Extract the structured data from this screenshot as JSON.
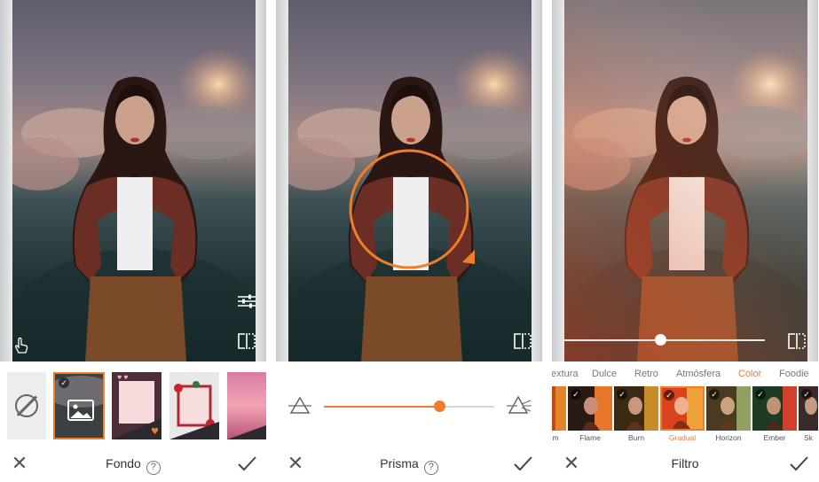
{
  "panels": [
    {
      "id": "fondo",
      "title": "Fondo",
      "has_help": true,
      "tray": {
        "type": "background-picker",
        "selected_index": 1,
        "tiles": [
          "none-icon",
          "image-icon",
          "pink-frame-hearts",
          "rose-frame",
          "pink-sunset"
        ]
      }
    },
    {
      "id": "prisma",
      "title": "Prisma",
      "has_help": true,
      "tray": {
        "type": "intensity-slider",
        "value_fraction": 0.68,
        "left_icon": "prism-icon",
        "right_icon": "prism-light-icon"
      }
    },
    {
      "id": "filtro",
      "title": "Filtro",
      "has_help": false,
      "intensity_fraction": 0.48,
      "tray": {
        "type": "filter-picker",
        "categories": [
          "extura",
          "Dulce",
          "Retro",
          "Atmósfera",
          "Color",
          "Foodie"
        ],
        "active_category": "Color",
        "filters": [
          "m",
          "Flame",
          "Burn",
          "Gradual",
          "Horizon",
          "Ember",
          "Sk"
        ],
        "active_filter": "Gradual"
      }
    }
  ],
  "accent_color": "#f07d2a",
  "icons": {
    "close": "close-icon",
    "apply": "check-icon",
    "help": "help-icon",
    "compare": "compare-icon",
    "adjust": "sliders-icon",
    "touch": "touch-icon"
  },
  "labels": {
    "fondo_title": "Fondo",
    "prisma_title": "Prisma",
    "filtro_title": "Filtro",
    "help_glyph": "?",
    "close_glyph": "✕",
    "check_glyph": "✓"
  }
}
